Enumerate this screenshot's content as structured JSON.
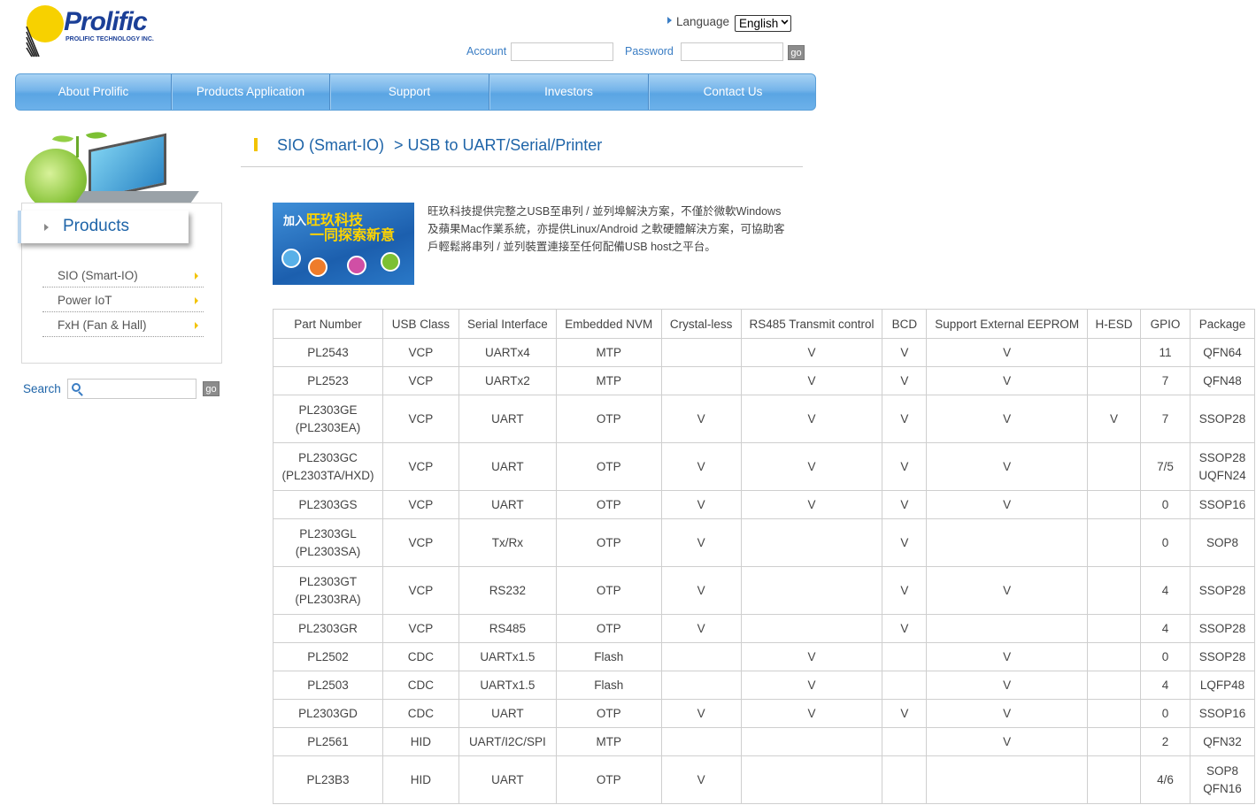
{
  "header": {
    "logo_text": "Prolific",
    "logo_sub": "PROLIFIC TECHNOLOGY INC.",
    "language_label": "Language",
    "language_value": "English",
    "account_label": "Account",
    "password_label": "Password",
    "go_label": "go"
  },
  "nav": {
    "items": [
      "About Prolific",
      "Products Application",
      "Support",
      "Investors",
      "Contact Us"
    ]
  },
  "sidebar": {
    "title": "Products",
    "items": [
      "SIO (Smart-IO)",
      "Power IoT",
      "FxH (Fan & Hall)"
    ],
    "search_label": "Search",
    "search_go": "go"
  },
  "breadcrumb": {
    "parent": "SIO (Smart-IO)",
    "current": "> USB to UART/Serial/Printer"
  },
  "banner": {
    "line1_a": "加入",
    "line1_b": "旺玖科技",
    "line2": "一同探索新意"
  },
  "intro": "旺玖科技提供完整之USB至串列 / 並列埠解決方案，不僅於微軟Windows及蘋果Mac作業系統，亦提供Linux/Android 之軟硬體解決方案，可協助客戶輕鬆將串列 / 並列裝置連接至任何配備USB host之平台。",
  "table": {
    "headers": [
      "Part Number",
      "USB Class",
      "Serial Interface",
      "Embedded NVM",
      "Crystal-less",
      "RS485 Transmit control",
      "BCD",
      "Support External EEPROM",
      "H-ESD",
      "GPIO",
      "Package"
    ],
    "rows": [
      {
        "part": "PL2543",
        "part2": "",
        "usb": "VCP",
        "serial": "UARTx4",
        "nvm": "MTP",
        "crystal": "",
        "rs485": "V",
        "bcd": "V",
        "eeprom": "V",
        "hesd": "",
        "gpio": "11",
        "pkg": "QFN64",
        "pkg2": ""
      },
      {
        "part": "PL2523",
        "part2": "",
        "usb": "VCP",
        "serial": "UARTx2",
        "nvm": "MTP",
        "crystal": "",
        "rs485": "V",
        "bcd": "V",
        "eeprom": "V",
        "hesd": "",
        "gpio": "7",
        "pkg": "QFN48",
        "pkg2": ""
      },
      {
        "part": "PL2303GE",
        "part2": "(PL2303EA)",
        "usb": "VCP",
        "serial": "UART",
        "nvm": "OTP",
        "crystal": "V",
        "rs485": "V",
        "bcd": "V",
        "eeprom": "V",
        "hesd": "V",
        "gpio": "7",
        "pkg": "SSOP28",
        "pkg2": ""
      },
      {
        "part": "PL2303GC",
        "part2": "(PL2303TA/HXD)",
        "usb": "VCP",
        "serial": "UART",
        "nvm": "OTP",
        "crystal": "V",
        "rs485": "V",
        "bcd": "V",
        "eeprom": "V",
        "hesd": "",
        "gpio": "7/5",
        "pkg": "SSOP28",
        "pkg2": "UQFN24"
      },
      {
        "part": "PL2303GS",
        "part2": "",
        "usb": "VCP",
        "serial": "UART",
        "nvm": "OTP",
        "crystal": "V",
        "rs485": "V",
        "bcd": "V",
        "eeprom": "V",
        "hesd": "",
        "gpio": "0",
        "pkg": "SSOP16",
        "pkg2": ""
      },
      {
        "part": "PL2303GL",
        "part2": "(PL2303SA)",
        "usb": "VCP",
        "serial": "Tx/Rx",
        "nvm": "OTP",
        "crystal": "V",
        "rs485": "",
        "bcd": "V",
        "eeprom": "",
        "hesd": "",
        "gpio": "0",
        "pkg": "SOP8",
        "pkg2": ""
      },
      {
        "part": "PL2303GT",
        "part2": "(PL2303RA)",
        "usb": "VCP",
        "serial": "RS232",
        "nvm": "OTP",
        "crystal": "V",
        "rs485": "",
        "bcd": "V",
        "eeprom": "V",
        "hesd": "",
        "gpio": "4",
        "pkg": "SSOP28",
        "pkg2": ""
      },
      {
        "part": "PL2303GR",
        "part2": "",
        "usb": "VCP",
        "serial": "RS485",
        "nvm": "OTP",
        "crystal": "V",
        "rs485": "",
        "bcd": "V",
        "eeprom": "",
        "hesd": "",
        "gpio": "4",
        "pkg": "SSOP28",
        "pkg2": ""
      },
      {
        "part": "PL2502",
        "part2": "",
        "usb": "CDC",
        "serial": "UARTx1.5",
        "nvm": "Flash",
        "crystal": "",
        "rs485": "V",
        "bcd": "",
        "eeprom": "V",
        "hesd": "",
        "gpio": "0",
        "pkg": "SSOP28",
        "pkg2": ""
      },
      {
        "part": "PL2503",
        "part2": "",
        "usb": "CDC",
        "serial": "UARTx1.5",
        "nvm": "Flash",
        "crystal": "",
        "rs485": "V",
        "bcd": "",
        "eeprom": "V",
        "hesd": "",
        "gpio": "4",
        "pkg": "LQFP48",
        "pkg2": ""
      },
      {
        "part": "PL2303GD",
        "part2": "",
        "usb": "CDC",
        "serial": "UART",
        "nvm": "OTP",
        "crystal": "V",
        "rs485": "V",
        "bcd": "V",
        "eeprom": "V",
        "hesd": "",
        "gpio": "0",
        "pkg": "SSOP16",
        "pkg2": ""
      },
      {
        "part": "PL2561",
        "part2": "",
        "usb": "HID",
        "serial": "UART/I2C/SPI",
        "nvm": "MTP",
        "crystal": "",
        "rs485": "",
        "bcd": "",
        "eeprom": "V",
        "hesd": "",
        "gpio": "2",
        "pkg": "QFN32",
        "pkg2": ""
      },
      {
        "part": "PL23B3",
        "part2": "",
        "usb": "HID",
        "serial": "UART",
        "nvm": "OTP",
        "crystal": "V",
        "rs485": "",
        "bcd": "",
        "eeprom": "",
        "hesd": "",
        "gpio": "4/6",
        "pkg": "SOP8",
        "pkg2": "QFN16"
      }
    ]
  },
  "colors": {
    "brand_blue": "#1e64a8",
    "nav_blue": "#6cb1ea",
    "accent_yellow": "#f2c300"
  }
}
